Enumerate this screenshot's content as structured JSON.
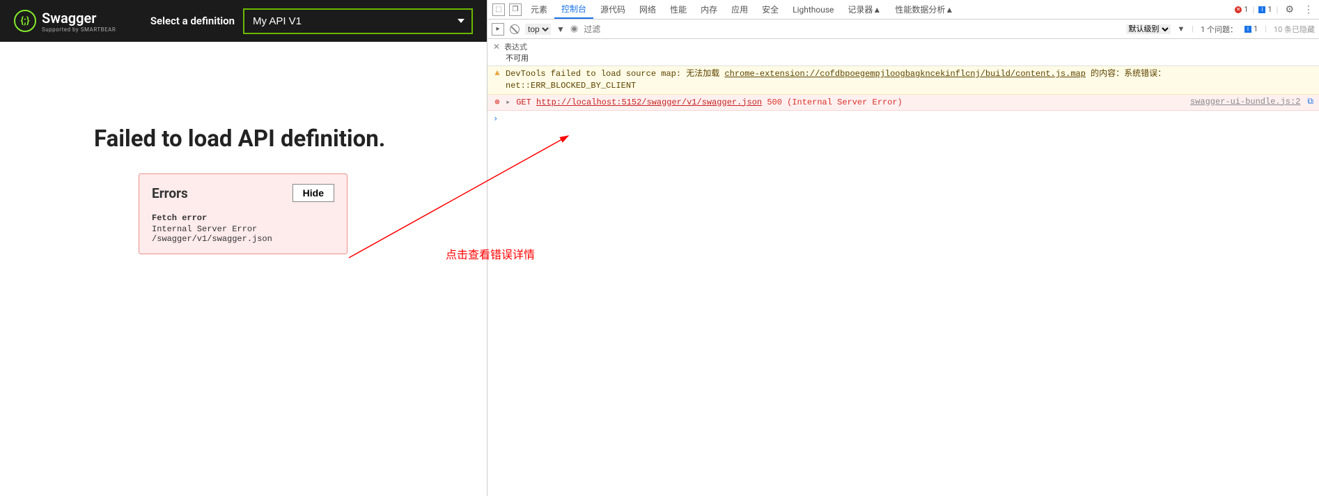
{
  "swagger": {
    "brand": "Swagger",
    "subtitle": "Supported by SMARTBEAR",
    "select_label": "Select a definition",
    "selected_definition": "My API V1"
  },
  "error_page": {
    "title": "Failed to load API definition.",
    "errors_heading": "Errors",
    "hide_button": "Hide",
    "fetch_error_label": "Fetch error",
    "fetch_error_detail": "Internal Server Error /swagger/v1/swagger.json"
  },
  "annotation": {
    "text": "点击查看错误详情"
  },
  "devtools": {
    "tabs": {
      "elements": "元素",
      "console": "控制台",
      "sources": "源代码",
      "network": "网络",
      "performance": "性能",
      "memory": "内存",
      "application": "应用",
      "security": "安全",
      "lighthouse": "Lighthouse",
      "recorder": "记录器",
      "perf_insights": "性能数据分析"
    },
    "error_count": "1",
    "info_count": "1",
    "filter": {
      "top": "top",
      "placeholder": "过滤",
      "default_level": "默认级别",
      "issues_label": "1 个问题：",
      "issues_count": "1",
      "hidden": "10 条已隐藏"
    },
    "expression": {
      "label": "表达式",
      "not_available": "不可用"
    },
    "console": {
      "warning": {
        "prefix": "DevTools failed to load source map: 无法加载",
        "url": "chrome-extension://cofdbpoegempjloogbagkncekinflcnj/build/content.js.map",
        "suffix": "的内容：系统错误：",
        "line2": "net::ERR_BLOCKED_BY_CLIENT"
      },
      "error": {
        "method": "GET",
        "url": "http://localhost:5152/swagger/v1/swagger.json",
        "status": "500 (Internal Server Error)",
        "source": "swagger-ui-bundle.js:2"
      }
    }
  }
}
